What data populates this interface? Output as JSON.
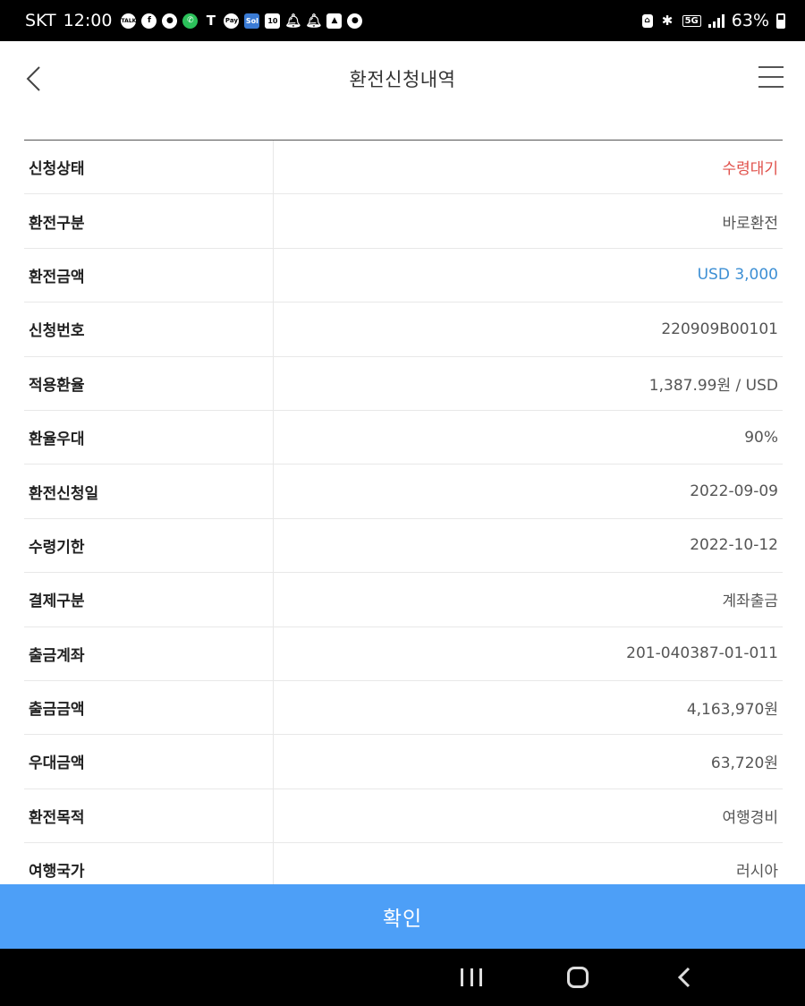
{
  "status_bar": {
    "carrier": "SKT",
    "time": "12:00",
    "icons": [
      "talk-icon",
      "facebook-icon",
      "chat-bubble-icon",
      "phone-icon",
      "t-icon",
      "pay-icon",
      "sol-icon",
      "calendar-icon",
      "bell-icon",
      "bell-icon",
      "gallery-icon",
      "chat-bubble-icon"
    ],
    "icon_labels": {
      "talk": "TALK",
      "pay": "Pay",
      "sol": "Sol",
      "calendar": "10",
      "t": "T"
    },
    "network": "5G",
    "battery": "63%"
  },
  "header": {
    "title": "환전신청내역"
  },
  "details": [
    {
      "label": "신청상태",
      "value": "수령대기",
      "color": "#e0504a"
    },
    {
      "label": "환전구분",
      "value": "바로환전"
    },
    {
      "label": "환전금액",
      "value": "USD 3,000",
      "color": "#3d8fd4"
    },
    {
      "label": "신청번호",
      "value": "220909B00101"
    },
    {
      "label": "적용환율",
      "value": "1,387.99원 / USD"
    },
    {
      "label": "환율우대",
      "value": "90%"
    },
    {
      "label": "환전신청일",
      "value": "2022-09-09"
    },
    {
      "label": "수령기한",
      "value": "2022-10-12"
    },
    {
      "label": "결제구분",
      "value": "계좌출금"
    },
    {
      "label": "출금계좌",
      "value": "201-040387-01-011"
    },
    {
      "label": "출금금액",
      "value": "4,163,970원"
    },
    {
      "label": "우대금액",
      "value": "63,720원"
    },
    {
      "label": "환전목적",
      "value": "여행경비"
    },
    {
      "label": "여행국가",
      "value": "러시아"
    }
  ],
  "confirm": {
    "label": "확인",
    "color": "#4d9ff7"
  }
}
